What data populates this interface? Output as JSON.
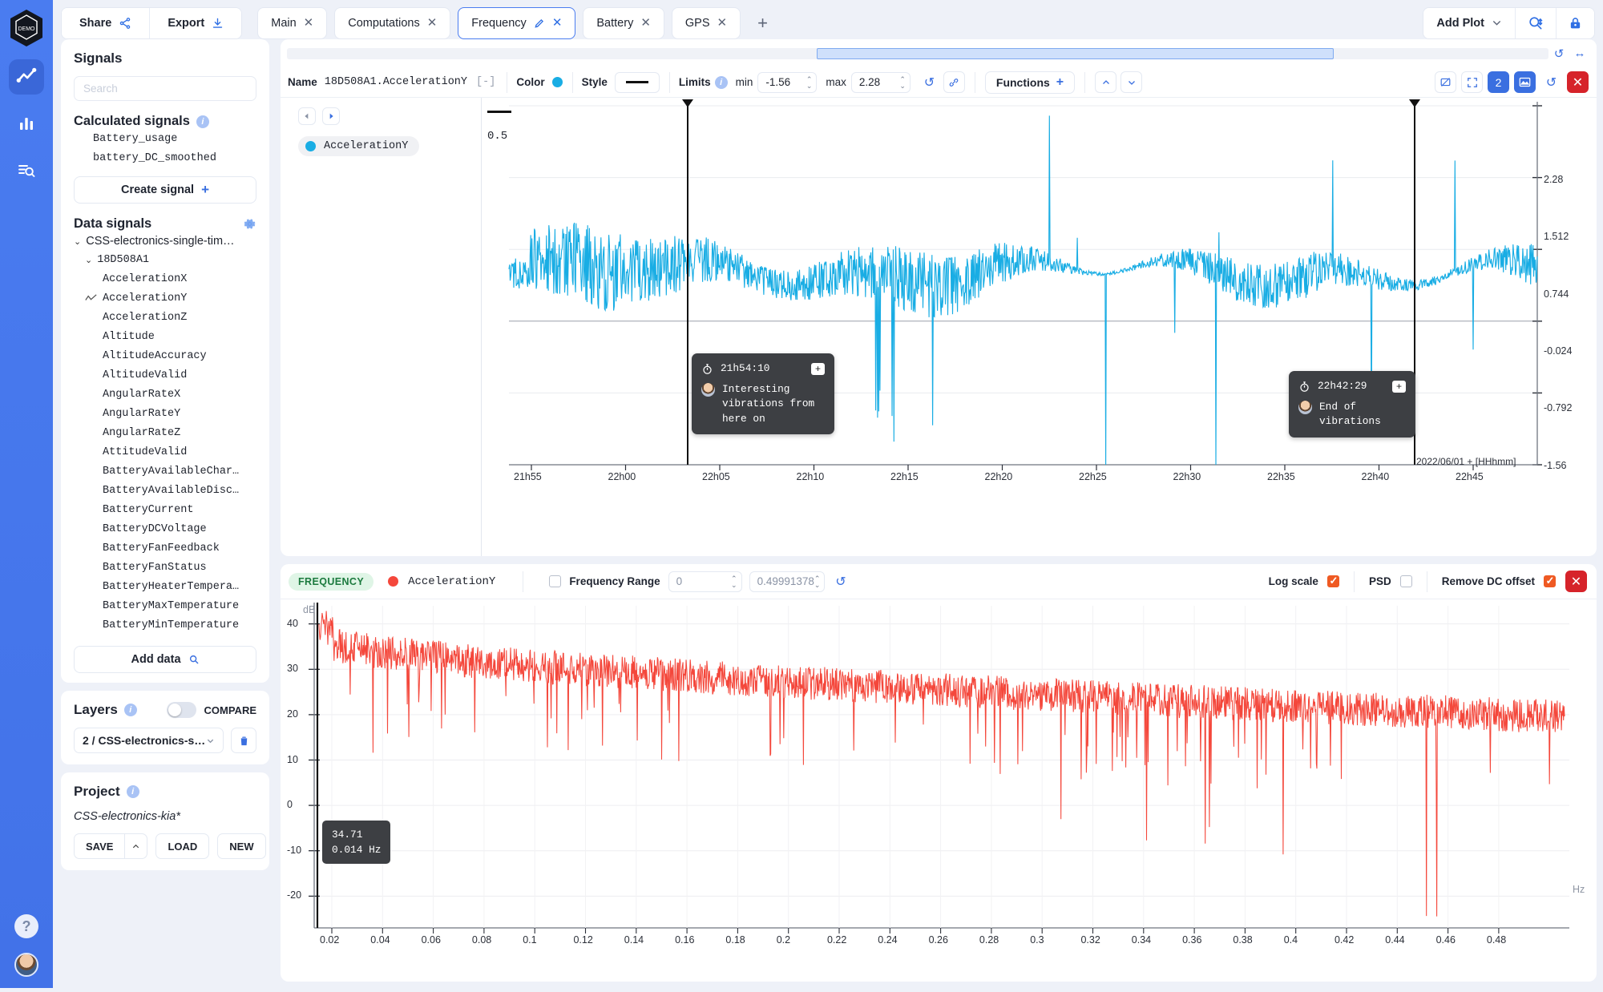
{
  "rail": {
    "logo_text": "DEMO",
    "items": [
      {
        "name": "timeseries-icon",
        "active": true
      },
      {
        "name": "bar-chart-icon",
        "active": false
      },
      {
        "name": "data-search-icon",
        "active": false
      }
    ],
    "help_label": "?",
    "avatar_label": ""
  },
  "topbar": {
    "share_label": "Share",
    "export_label": "Export",
    "add_plot_label": "Add Plot",
    "tabs": [
      {
        "label": "Main",
        "active": false,
        "editable": false
      },
      {
        "label": "Computations",
        "active": false,
        "editable": false
      },
      {
        "label": "Frequency",
        "active": true,
        "editable": true
      },
      {
        "label": "Battery",
        "active": false,
        "editable": false
      },
      {
        "label": "GPS",
        "active": false,
        "editable": false
      }
    ],
    "add_tab_label": "+",
    "search_icon": "search-zoom-icon",
    "lock_icon": "lock-icon"
  },
  "sidebar": {
    "signals_title": "Signals",
    "search_placeholder": "Search",
    "calculated_title": "Calculated signals",
    "calculated_signals": [
      "Battery_usage",
      "battery_DC_smoothed"
    ],
    "create_signal_label": "Create signal",
    "data_signals_title": "Data signals",
    "tree_root": "CSS-electronics-single-tim…",
    "tree_device": "18D508A1",
    "data_signals": [
      "AccelerationX",
      "AccelerationY",
      "AccelerationZ",
      "Altitude",
      "AltitudeAccuracy",
      "AltitudeValid",
      "AngularRateX",
      "AngularRateY",
      "AngularRateZ",
      "AttitudeValid",
      "BatteryAvailableChar…",
      "BatteryAvailableDisc…",
      "BatteryCurrent",
      "BatteryDCVoltage",
      "BatteryFanFeedback",
      "BatteryFanStatus",
      "BatteryHeaterTempera…",
      "BatteryMaxTemperature",
      "BatteryMinTemperature"
    ],
    "selected_signal": "AccelerationY",
    "add_data_label": "Add data",
    "layers_title": "Layers",
    "compare_label": "COMPARE",
    "compare_on": false,
    "layer_value": "2 / CSS-electronics-sin…",
    "project_title": "Project",
    "project_name": "CSS-electronics-kia*",
    "save_label": "SAVE",
    "load_label": "LOAD",
    "new_label": "NEW"
  },
  "timeplot": {
    "name_label": "Name",
    "signal_name": "18D508A1.AccelerationY",
    "unit": "[-]",
    "color_label": "Color",
    "color_value": "#19ade4",
    "style_label": "Style",
    "limits_label": "Limits",
    "min_label": "min",
    "min_value": "-1.56",
    "max_label": "max",
    "max_value": "2.28",
    "functions_label": "Functions",
    "legend_signal": "AccelerationY",
    "legend_value": "0.5",
    "y_ticks": [
      "2.28",
      "1.512",
      "0.744",
      "-0.024",
      "-0.792",
      "-1.56"
    ],
    "x_ticks": [
      "21h55",
      "22h00",
      "22h05",
      "22h10",
      "22h15",
      "22h20",
      "22h25",
      "22h30",
      "22h35",
      "22h40",
      "22h45"
    ],
    "x_axis_label": "2022/06/01 + [HHhmm]",
    "annotations": [
      {
        "time": "21h54:10",
        "text": "Interesting\nvibrations from\nhere on"
      },
      {
        "time": "22h42:29",
        "text": "End of vibrations"
      }
    ]
  },
  "freqplot": {
    "badge": "FREQUENCY",
    "signal_name": "AccelerationY",
    "signal_color": "#f4473b",
    "range_label": "Frequency Range",
    "range_checked": false,
    "range_min": "0",
    "range_max": "0.49991378",
    "log_scale_label": "Log scale",
    "log_scale_checked": true,
    "psd_label": "PSD",
    "psd_checked": false,
    "remove_dc_label": "Remove DC offset",
    "remove_dc_checked": true,
    "y_axis_unit": "dB",
    "x_axis_unit": "Hz",
    "y_ticks": [
      "40",
      "30",
      "20",
      "10",
      "0",
      "-10",
      "-20"
    ],
    "x_ticks": [
      "0.02",
      "0.04",
      "0.06",
      "0.08",
      "0.1",
      "0.12",
      "0.14",
      "0.16",
      "0.18",
      "0.2",
      "0.22",
      "0.24",
      "0.26",
      "0.28",
      "0.3",
      "0.32",
      "0.34",
      "0.36",
      "0.38",
      "0.4",
      "0.42",
      "0.44",
      "0.46",
      "0.48"
    ],
    "cursor_tooltip": {
      "value": "34.71",
      "freq": "0.014 Hz"
    }
  },
  "chart_data": [
    {
      "type": "line",
      "title": "18D508A1.AccelerationY",
      "xlabel": "2022/06/01 + [HHhmm]",
      "ylabel": "[-]",
      "ylim": [
        -1.56,
        2.28
      ],
      "yticks": [
        2.28,
        1.512,
        0.744,
        -0.024,
        -0.792,
        -1.56
      ],
      "xticks": [
        "21h55",
        "22h00",
        "22h05",
        "22h10",
        "22h15",
        "22h20",
        "22h25",
        "22h30",
        "22h35",
        "22h40",
        "22h45"
      ],
      "series": [
        {
          "name": "AccelerationY",
          "color": "#19ade4",
          "mean": 0.5
        }
      ],
      "legend": "top-left",
      "grid": true,
      "cursors": [
        {
          "label": "21h54:10"
        },
        {
          "label": "22h42:29"
        }
      ]
    },
    {
      "type": "line",
      "title": "FREQUENCY AccelerationY",
      "xlabel": "Hz",
      "ylabel": "dB",
      "ylim": [
        -27,
        44
      ],
      "yticks": [
        40,
        30,
        20,
        10,
        0,
        -10,
        -20
      ],
      "xlim": [
        0,
        0.49991378
      ],
      "series": [
        {
          "name": "AccelerationY",
          "color": "#f4473b"
        }
      ],
      "grid": true,
      "log_scale": true,
      "psd": false,
      "remove_dc_offset": true,
      "cursor": {
        "value": 34.71,
        "freq": 0.014
      }
    }
  ]
}
